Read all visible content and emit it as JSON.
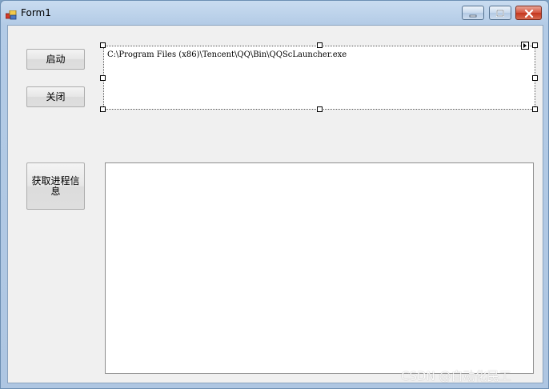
{
  "window": {
    "title": "Form1",
    "controls": {
      "minimize": "minimize",
      "maximize": "maximize",
      "close": "close"
    }
  },
  "buttons": {
    "start_label": "启动",
    "close_label": "关闭",
    "process_info_label": "获取进程信息"
  },
  "path_box": {
    "value": "C:\\Program Files (x86)\\Tencent\\QQ\\Bin\\QQScLauncher.exe"
  },
  "watermark": "CSDN @自动化民工",
  "colors": {
    "client_bg": "#f0f0f0",
    "close_button": "#c4361e",
    "titlebar": "#b3cbe6"
  }
}
